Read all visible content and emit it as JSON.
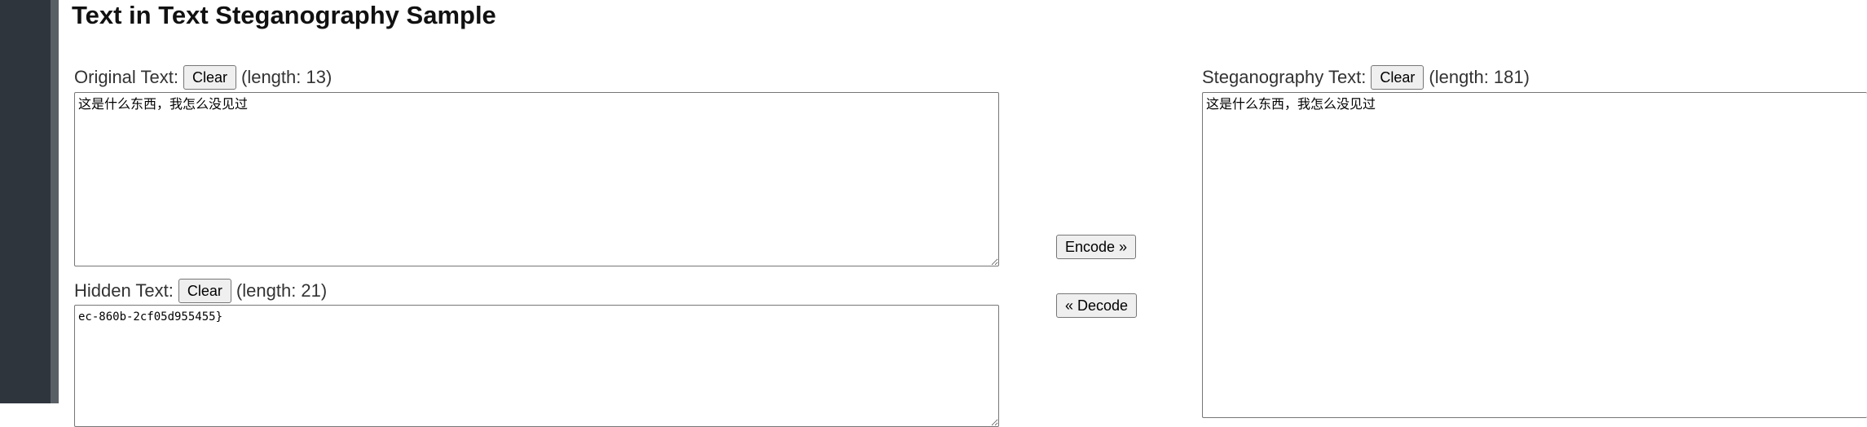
{
  "page": {
    "title": "Text in Text Steganography Sample"
  },
  "original": {
    "label": "Original Text:",
    "clear_label": "Clear",
    "length_text": "(length: 13)",
    "value": "这是什么东西，我怎么没见过"
  },
  "hidden": {
    "label": "Hidden Text:",
    "clear_label": "Clear",
    "length_text": "(length: 21)",
    "value": "ec-860b-2cf05d955455}"
  },
  "actions": {
    "encode_label": "Encode »",
    "decode_label": "« Decode"
  },
  "stego": {
    "label": "Steganography Text:",
    "clear_label": "Clear",
    "length_text": "(length: 181)",
    "value": "这是什么东西，我怎么没见过"
  },
  "colors": {
    "sidebar": "#2e353d",
    "sidebar_edge": "#5a5f66",
    "button_bg": "#efefef"
  }
}
